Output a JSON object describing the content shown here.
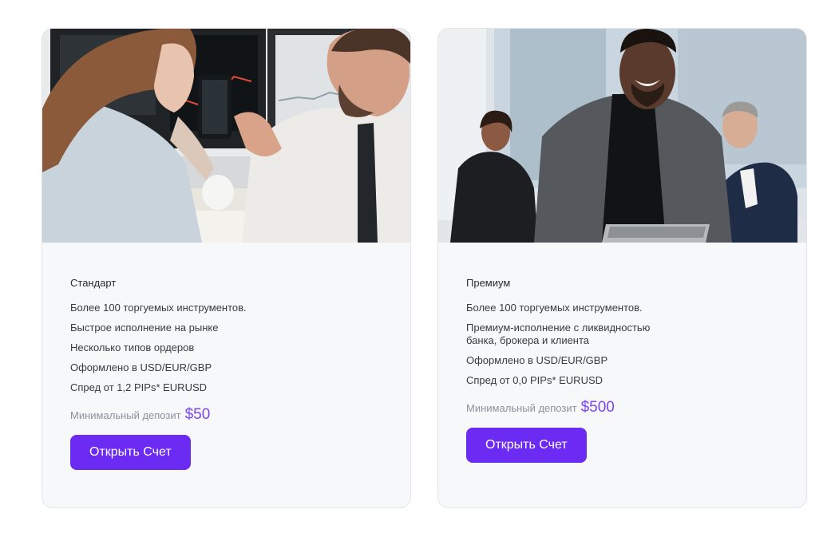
{
  "cards": [
    {
      "plan": "Стандарт",
      "features": [
        "Более 100 торгуемых инструментов.",
        "Быстрое исполнение на рынке",
        "Несколько типов ордеров",
        "Оформлено в USD/EUR/GBP",
        "Спред от 1,2 PIPs* EURUSD"
      ],
      "deposit_label": "Минимальный депозит",
      "deposit_value": "$50",
      "button_label": "Открыть Счет"
    },
    {
      "plan": "Премиум",
      "features": [
        "Более 100 торгуемых инструментов.",
        "Премиум-исполнение с ликвидностью банка, брокера и клиента",
        "Оформлено в USD/EUR/GBP",
        "Спред от 0,0 PIPs* EURUSD"
      ],
      "deposit_label": "Минимальный депозит",
      "deposit_value": "$500",
      "button_label": "Открыть Счет"
    }
  ],
  "colors": {
    "accent": "#6c2bf2",
    "deposit_value": "#7a45f0",
    "card_background": "#f7f8fa"
  }
}
